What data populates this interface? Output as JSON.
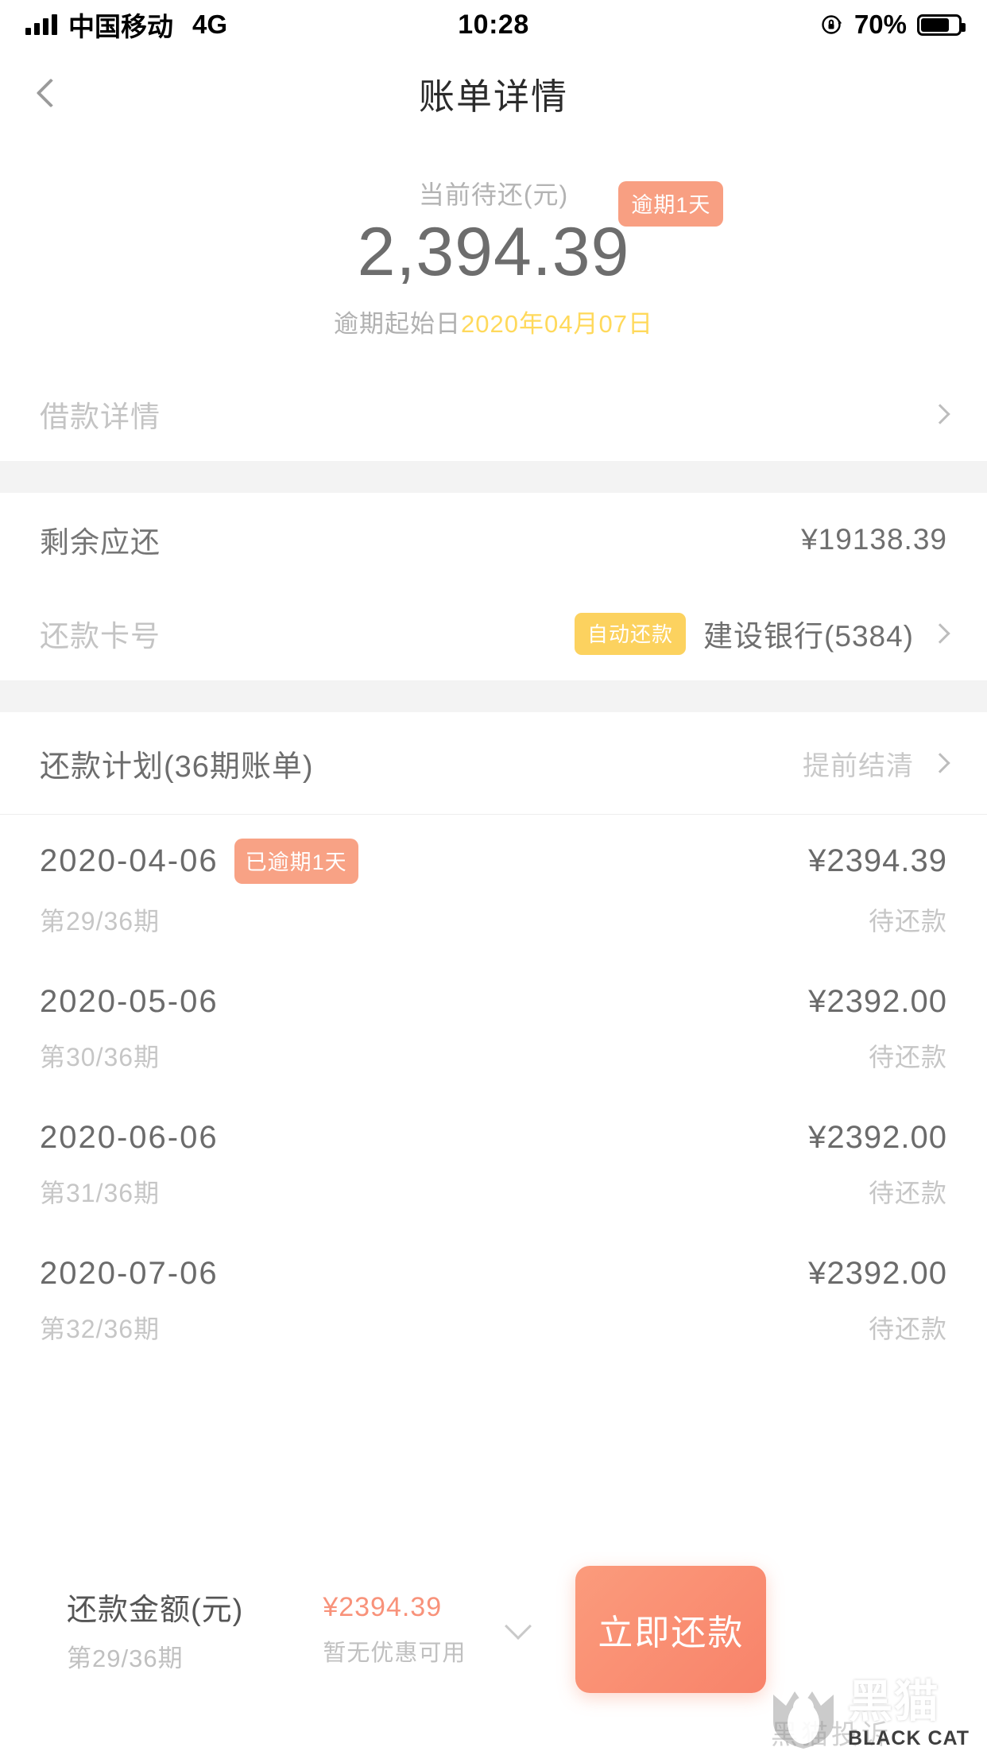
{
  "status_bar": {
    "carrier": "中国移动",
    "network": "4G",
    "time": "10:28",
    "battery_percent": "70%",
    "signal_icon": "signal-bars-icon",
    "rotation_lock_icon": "rotation-lock-icon",
    "battery_icon": "battery-icon"
  },
  "nav": {
    "back_icon": "chevron-left-icon",
    "title": "账单详情"
  },
  "hero": {
    "label": "当前待还(元)",
    "amount": "2,394.39",
    "overdue_badge": "逾期1天",
    "overdue_start_label": "逾期起始日",
    "overdue_start_date": "2020年04月07日"
  },
  "loan_detail_row": {
    "label": "借款详情",
    "chevron_icon": "chevron-right-icon"
  },
  "remaining_row": {
    "label": "剩余应还",
    "value": "¥19138.39"
  },
  "card_row": {
    "label": "还款卡号",
    "auto_badge": "自动还款",
    "value": "建设银行(5384)",
    "chevron_icon": "chevron-right-icon"
  },
  "plan": {
    "title": "还款计划(36期账单)",
    "action": "提前结清",
    "chevron_icon": "chevron-right-icon",
    "installments": [
      {
        "date": "2020-04-06",
        "flag": "已逾期1天",
        "amount": "¥2394.39",
        "term": "第29/36期",
        "status": "待还款"
      },
      {
        "date": "2020-05-06",
        "flag": "",
        "amount": "¥2392.00",
        "term": "第30/36期",
        "status": "待还款"
      },
      {
        "date": "2020-06-06",
        "flag": "",
        "amount": "¥2392.00",
        "term": "第31/36期",
        "status": "待还款"
      },
      {
        "date": "2020-07-06",
        "flag": "",
        "amount": "¥2392.00",
        "term": "第32/36期",
        "status": "待还款"
      }
    ]
  },
  "action_bar": {
    "amount_label": "还款金额(元)",
    "term": "第29/36期",
    "amount": "¥2394.39",
    "promo": "暂无优惠可用",
    "expand_icon": "chevron-down-icon",
    "pay_button": "立即还款"
  },
  "watermark": {
    "cn": "黑猫",
    "en": "BLACK CAT",
    "side_text": "黑猫投诉",
    "logo_icon": "black-cat-logo-icon"
  },
  "colors": {
    "accent_coral": "#f8876a",
    "badge_coral": "#f89f82",
    "badge_yellow": "#fcd25f",
    "date_yellow": "#ffd95b",
    "text_primary": "#6b6b6b",
    "text_muted": "#c6c6c6",
    "divider_gray": "#f3f3f3"
  }
}
